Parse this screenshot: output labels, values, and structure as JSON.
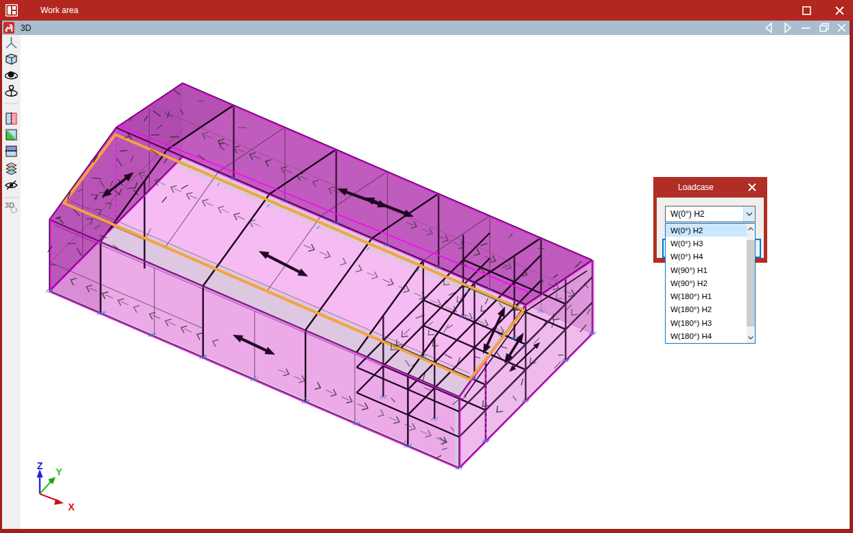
{
  "window": {
    "title": "Work area",
    "maximize": "maximize",
    "close": "close"
  },
  "tabbar": {
    "title": "3D"
  },
  "toolbar": {
    "icons": [
      "ucs-axes",
      "view-cube",
      "orbit-view",
      "rotate-view",
      "section-view",
      "render-mode",
      "clip-planes",
      "layers",
      "hide-elements",
      "3d-settings"
    ],
    "settings_icon_text": "3D"
  },
  "axes": {
    "x": "X",
    "y": "Y",
    "z": "Z"
  },
  "loadcase": {
    "dialog_title": "Loadcase",
    "combo_value": "W(0°) H2",
    "items": [
      "W(0°) H2",
      "W(0°) H3",
      "W(0°) H4",
      "W(90°) H1",
      "W(90°) H2",
      "W(180°) H1",
      "W(180°) H2",
      "W(180°) H3",
      "W(180°) H4"
    ],
    "selected_index": 0
  },
  "colors": {
    "titlebar": "#b2271f",
    "tabbar": "#a9bdce",
    "accent_orange": "#f2a43d",
    "model_magenta": "#ff00ff",
    "list_selection": "#cce8ff",
    "dialog_red": "#b02e26"
  }
}
